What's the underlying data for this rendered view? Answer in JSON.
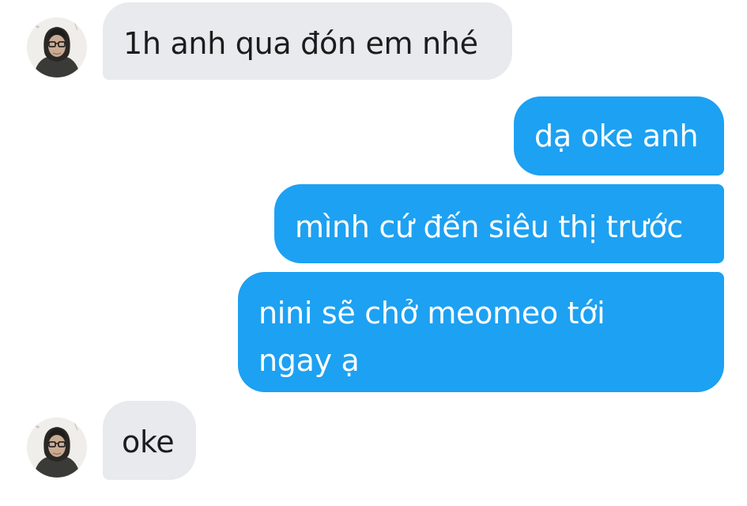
{
  "conversation": {
    "messages": [
      {
        "sender": "them",
        "text": "1h anh qua đón em nhé"
      },
      {
        "sender": "me",
        "text": "dạ oke anh"
      },
      {
        "sender": "me",
        "text": "mình cứ đến siêu thị trước"
      },
      {
        "sender": "me",
        "text": "nini sẽ chở meomeo tới\nngay ạ"
      },
      {
        "sender": "them",
        "text": "oke"
      }
    ]
  },
  "colors": {
    "outgoing_bubble": "#1da1f2",
    "incoming_bubble": "#e8eaed",
    "outgoing_text": "#ffffff",
    "incoming_text": "#1c1c1c",
    "background": "#ffffff"
  },
  "icons": {
    "avatar": "contact-avatar-photo"
  }
}
